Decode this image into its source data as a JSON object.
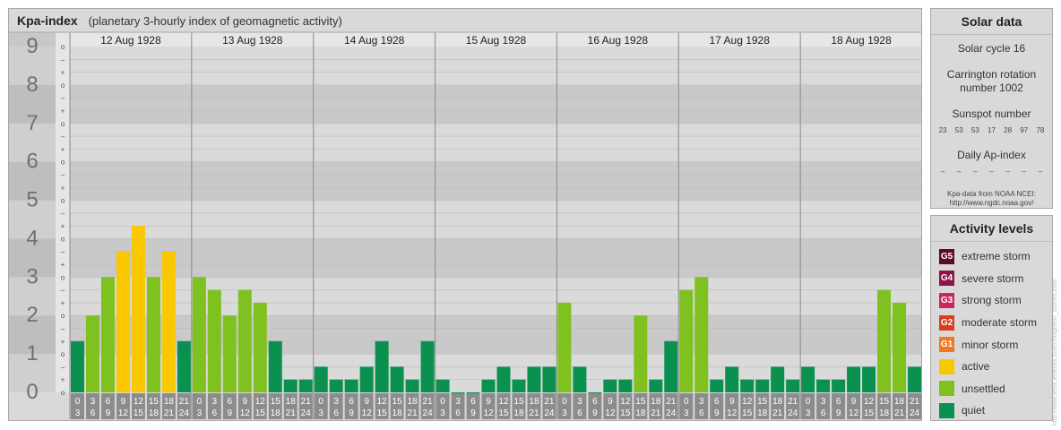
{
  "header": {
    "title": "Kpa-index",
    "subtitle": "(planetary 3-hourly index of geomagnetic activity)"
  },
  "chart_data": {
    "type": "bar",
    "title": "Kpa-index",
    "ylim": [
      0,
      9
    ],
    "y_ticks": [
      "0",
      "1",
      "2",
      "3",
      "4",
      "5",
      "6",
      "7",
      "8",
      "9"
    ],
    "y_minor_marks": [
      "o",
      "+",
      "–",
      "o",
      "+",
      "–",
      "o",
      "+",
      "–",
      "o",
      "+",
      "–",
      "o",
      "+",
      "–",
      "o",
      "+",
      "–",
      "o",
      "+",
      "–",
      "o",
      "+",
      "–",
      "o",
      "+",
      "–",
      "o"
    ],
    "days": [
      "12 Aug 1928",
      "13 Aug 1928",
      "14 Aug 1928",
      "15 Aug 1928",
      "16 Aug 1928",
      "17 Aug 1928",
      "18 Aug 1928"
    ],
    "interval_top": [
      "0",
      "3",
      "6",
      "9",
      "12",
      "15",
      "18",
      "21"
    ],
    "interval_bottom": [
      "3",
      "6",
      "9",
      "12",
      "15",
      "18",
      "21",
      "24"
    ],
    "values": [
      [
        1.333,
        2.0,
        3.0,
        3.667,
        4.333,
        3.0,
        3.667,
        1.333
      ],
      [
        3.0,
        2.667,
        2.0,
        2.667,
        2.333,
        1.333,
        0.333,
        0.333
      ],
      [
        0.667,
        0.333,
        0.333,
        0.667,
        1.333,
        0.667,
        0.333,
        1.333
      ],
      [
        0.333,
        0.0,
        0.0,
        0.333,
        0.667,
        0.333,
        0.667,
        0.667
      ],
      [
        2.333,
        0.667,
        0.0,
        0.333,
        0.333,
        2.0,
        0.333,
        1.333
      ],
      [
        2.667,
        3.0,
        0.333,
        0.667,
        0.333,
        0.333,
        0.667,
        0.333
      ],
      [
        0.667,
        0.333,
        0.333,
        0.667,
        0.667,
        2.667,
        2.333,
        0.667
      ]
    ],
    "level_colors": {
      "quiet": "#0a9150",
      "unsettled": "#7fc21f",
      "active": "#fac800"
    }
  },
  "solar": {
    "title": "Solar data",
    "cycle": "Solar cycle 16",
    "carrington_line1": "Carrington rotation",
    "carrington_line2": "number 1002",
    "sunspot_title": "Sunspot number",
    "sunspot_values": [
      "23",
      "53",
      "53",
      "17",
      "28",
      "97",
      "78"
    ],
    "ap_title": "Daily Ap-index",
    "ap_values": [
      "–",
      "–",
      "–",
      "–",
      "–",
      "–",
      "–"
    ],
    "source_line1": "Kpa-data from NOAA NCEI:",
    "source_line2": "http://www.ngdc.noaa.gov/"
  },
  "activity": {
    "title": "Activity levels",
    "levels": [
      {
        "code": "G5",
        "label": "extreme storm",
        "color": "#5a0a28"
      },
      {
        "code": "G4",
        "label": "severe storm",
        "color": "#8c1446"
      },
      {
        "code": "G3",
        "label": "strong storm",
        "color": "#c8285a"
      },
      {
        "code": "G2",
        "label": "moderate storm",
        "color": "#dc3c1e"
      },
      {
        "code": "G1",
        "label": "minor storm",
        "color": "#f0781e"
      },
      {
        "code": "",
        "label": "active",
        "color": "#fac800"
      },
      {
        "code": "",
        "label": "unsettled",
        "color": "#7fc21f"
      },
      {
        "code": "",
        "label": "quiet",
        "color": "#0a9150"
      }
    ]
  },
  "credit": "http://www.tesis.lebedev.ru/en/magnetic_storms.html"
}
